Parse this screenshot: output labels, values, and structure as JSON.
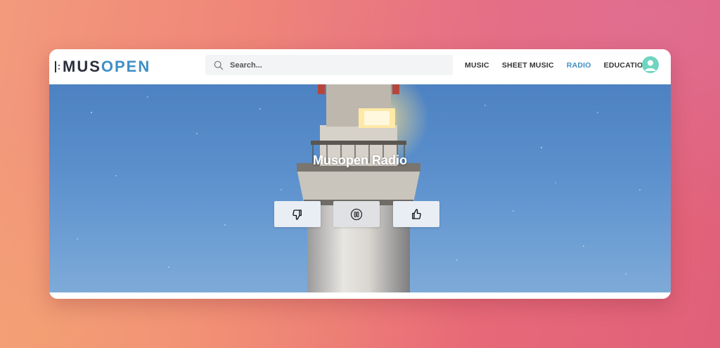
{
  "brand": {
    "part1": "MUS",
    "part2": "OPEN",
    "accent_color": "#3f8fc6",
    "dark_color": "#2a2f3a"
  },
  "search": {
    "placeholder": "Search...",
    "icon": "search-icon"
  },
  "nav": {
    "items": [
      {
        "label": "MUSIC",
        "active": false
      },
      {
        "label": "SHEET MUSIC",
        "active": false
      },
      {
        "label": "RADIO",
        "active": true
      },
      {
        "label": "EDUCATION",
        "active": false
      }
    ]
  },
  "user": {
    "avatar_icon": "user-avatar-icon",
    "avatar_color": "#6fd4c0"
  },
  "hero": {
    "title": "Musopen Radio"
  },
  "controls": [
    {
      "name": "dislike-button",
      "icon": "thumbs-down-icon"
    },
    {
      "name": "pause-button",
      "icon": "pause-circle-icon"
    },
    {
      "name": "like-button",
      "icon": "thumbs-up-icon"
    }
  ]
}
